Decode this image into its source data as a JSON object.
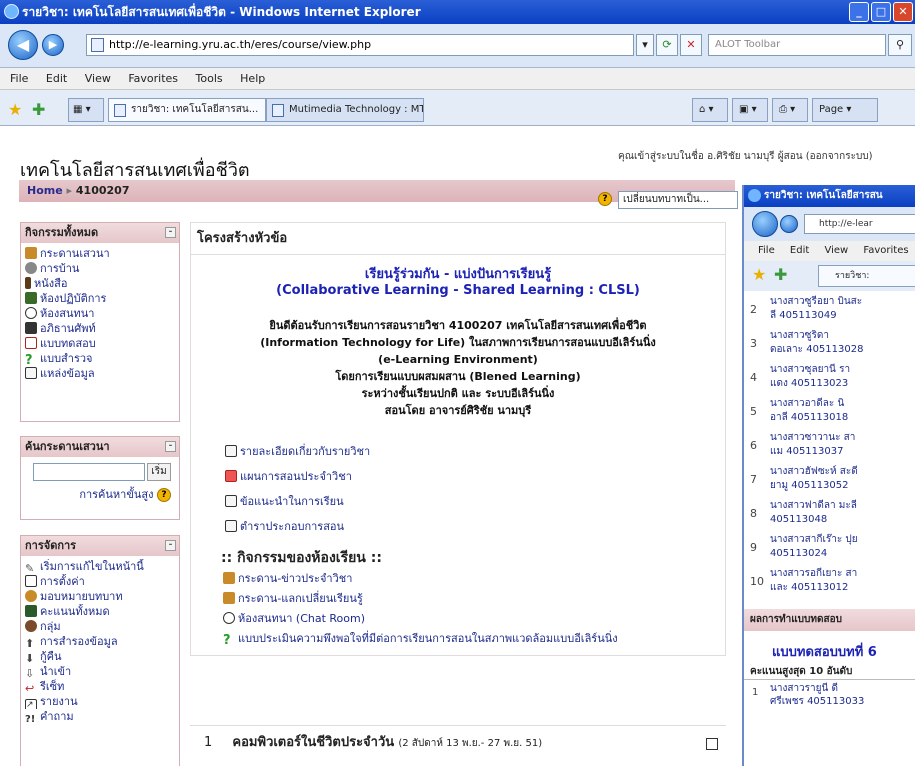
{
  "browser": {
    "title": "รายวิชา: เทคโนโลยีสารสนเทศเพื่อชีวิต - Windows Internet Explorer",
    "url": "http://e-learning.yru.ac.th/eres/course/view.php",
    "search_placeholder": "ALOT Toolbar",
    "menu": [
      "File",
      "Edit",
      "View",
      "Favorites",
      "Tools",
      "Help"
    ],
    "tabs": [
      "รายวิชา: เทคโนโลยีสารสน...",
      "Mutimedia Technology : MT-Y..."
    ],
    "page_menu": "Page"
  },
  "site": {
    "title": "เทคโนโลยีสารสนเทศเพื่อชีวิต",
    "login_info": "คุณเข้าสู่ระบบในชื่อ อ.ศิริชัย นามบุรี ผู้สอน (ออกจากระบบ)",
    "breadcrumb_home": "Home",
    "breadcrumb_course": "4100207",
    "role_select": "เปลี่ยนบทบาทเป็น..."
  },
  "activities_block": {
    "title": "กิจกรรมทั้งหมด",
    "items": [
      "กระดานเสวนา",
      "การบ้าน",
      "หนังสือ",
      "ห้องปฏิบัติการ",
      "ห้องสนทนา",
      "อภิธานศัพท์",
      "แบบทดสอบ",
      "แบบสำรวจ",
      "แหล่งข้อมูล"
    ]
  },
  "search_block": {
    "title": "ค้นกระดานเสวนา",
    "button": "เริ่ม",
    "advanced": "การค้นหาขั้นสูง"
  },
  "admin_block": {
    "title": "การจัดการ",
    "items": [
      "เริ่มการแก้ไขในหน้านี้",
      "การตั้งค่า",
      "มอบหมายบทบาท",
      "คะแนนทั้งหมด",
      "กลุ่ม",
      "การสำรองข้อมูล",
      "กู้คืน",
      "นำเข้า",
      "รีเซ็ท",
      "รายงาน",
      "คำถาม"
    ]
  },
  "main": {
    "header": "โครงสร้างหัวข้อ",
    "intro_title1": "เรียนรู้ร่วมกัน - แบ่งปันการเรียนรู้",
    "intro_title2": "(Collaborative Learning - Shared Learning : CLSL)",
    "intro_lines": [
      "ยินดีต้อนรับการเรียนการสอนรายวิชา 4100207 เทคโนโลยีสารสนเทศเพื่อชีวิต",
      "(Information Technology for Life) ในสภาพการเรียนการสอนแบบอีเลิร์นนิ่ง",
      "(e-Learning Environment)",
      "โดยการเรียนแบบผสมผสาน (Blened Learning)",
      "ระหว่างชั้นเรียนปกติ และ ระบบอีเลิร์นนิ่ง",
      "สอนโดย อาจารย์ศิริชัย นามบุรี"
    ],
    "resources": [
      "รายละเอียดเกี่ยวกับรายวิชา",
      "แผนการสอนประจำวิชา",
      "ข้อแนะนำในการเรียน",
      "ตำราประกอบการสอน"
    ],
    "activities_title": ":: กิจกรรมของห้องเรียน ::",
    "activities": [
      "กระดาน-ข่าวประจำวิชา",
      "กระดาน-แลกเปลี่ยนเรียนรู้",
      "ห้องสนทนา (Chat Room)",
      "แบบประเมินความพึงพอใจที่มีต่อการเรียนการสอนในสภาพแวดล้อมแบบอีเลิร์นนิ่ง"
    ],
    "topic_num": "1",
    "topic_title": "คอมพิวเตอร์ในชีวิตประจำวัน",
    "topic_date": "(2 สัปดาห์ 13 พ.ย.- 27 พ.ย. 51)"
  },
  "overlay": {
    "title": "รายวิชา: เทคโนโลยีสารสน",
    "url": "http://e-lear",
    "menu": [
      "File",
      "Edit",
      "View",
      "Favorites"
    ],
    "tab": "รายวิชา:",
    "list": [
      {
        "n": "2",
        "line1": "นางสาวซูรีอยา บินสะ",
        "line2": "ลี 405113049"
      },
      {
        "n": "3",
        "line1": "นางสาวซูริดา",
        "line2": "ดอเลาะ 405113028"
      },
      {
        "n": "4",
        "line1": "นางสาวซุลยานี รา",
        "line2": "แดง 405113023"
      },
      {
        "n": "5",
        "line1": "นางสาวอาดีละ นิ",
        "line2": "อาลี 405113018"
      },
      {
        "n": "6",
        "line1": "นางสาวซาวานะ สา",
        "line2": "แม 405113037"
      },
      {
        "n": "7",
        "line1": "นางสาวฮัฟซะห์ สะดี",
        "line2": "ยามู 405113052"
      },
      {
        "n": "8",
        "line1": "นางสาวฟาดีลา มะลี",
        "line2": "405113048"
      },
      {
        "n": "9",
        "line1": "นางสาวสากีเร๊าะ ปุย",
        "line2": "405113024"
      },
      {
        "n": "10",
        "line1": "นางสาวรอกีเยาะ สา",
        "line2": "และ 405113012"
      }
    ],
    "section": "ผลการทำแบบทดสอบ",
    "quiz": "แบบทดสอบบทที่ 6",
    "max": "คะแนนสูงสุด 10 อันดับ",
    "top_n": "1",
    "top_line1": "นางสาวรายูนี ดี",
    "top_line2": "ศรีเพชร 405113033"
  },
  "colors": {
    "accent": "#1c22b4",
    "block_header": "#e6c6c9",
    "ie_blue": "#0a3fc2"
  }
}
